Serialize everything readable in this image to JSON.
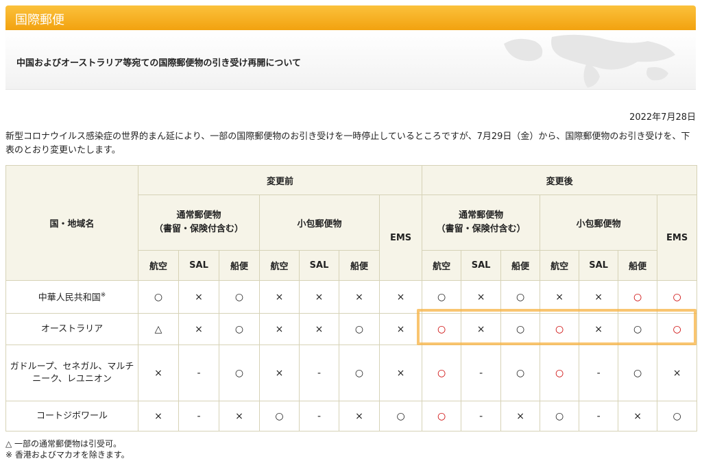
{
  "header": {
    "title": "国際郵便"
  },
  "subheader": {
    "text": "中国およびオーストラリア等宛ての国際郵便物の引き受け再開について"
  },
  "date": "2022年7月28日",
  "notice": "新型コロナウイルス感染症の世界的まん延により、一部の国際郵便物のお引き受けを一時停止しているところですが、7月29日（金）から、国際郵便物のお引き受けを、下表のとおり変更いたします。",
  "table": {
    "country_header": "国・地域名",
    "before_header": "変更前",
    "after_header": "変更後",
    "regular_mail": "通常郵便物\n（書留・保険付含む）",
    "regular_mail_after": "通常郵便物\n（書留・保険付含む）",
    "parcel": "小包郵便物",
    "ems": "EMS",
    "air": "航空",
    "sal": "SAL",
    "ship": "船便",
    "rows": [
      {
        "country": "中華人民共和国",
        "sup": "※",
        "cells": [
          "○",
          "×",
          "○",
          "×",
          "×",
          "×",
          "×",
          "○",
          "×",
          "○",
          "×",
          "×",
          "○",
          "○"
        ]
      },
      {
        "country": "オーストラリア",
        "sup": "",
        "cells": [
          "△",
          "×",
          "○",
          "×",
          "×",
          "○",
          "×",
          "○",
          "×",
          "○",
          "○",
          "×",
          "○",
          "○"
        ]
      },
      {
        "country": "ガドループ、セネガル、マルチニーク、レユニオン",
        "sup": "",
        "cells": [
          "×",
          "-",
          "○",
          "×",
          "-",
          "○",
          "×",
          "○",
          "-",
          "○",
          "○",
          "-",
          "○",
          "×"
        ]
      },
      {
        "country": "コートジボワール",
        "sup": "",
        "cells": [
          "×",
          "-",
          "×",
          "○",
          "-",
          "×",
          "○",
          "○",
          "-",
          "×",
          "○",
          "-",
          "×",
          "○"
        ]
      }
    ]
  },
  "footnotes": [
    "△ 一部の通常郵便物は引受可。",
    "※ 香港およびマカオを除きます。"
  ],
  "colors": {
    "banner": "#f5a915",
    "highlight": "#f7b240",
    "red": "#cc0000",
    "header_bg": "#f6f4e8"
  }
}
